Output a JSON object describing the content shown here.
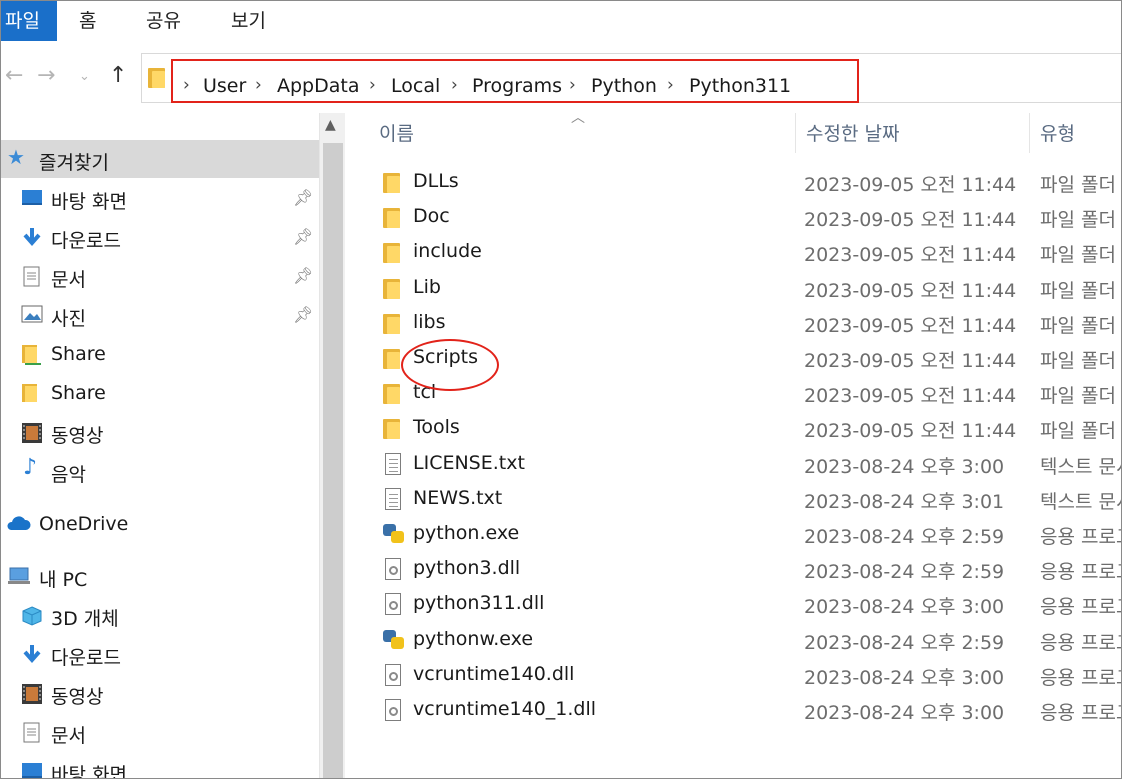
{
  "ribbon": {
    "tabs": [
      "파일",
      "홈",
      "공유",
      "보기"
    ],
    "active_index": 0
  },
  "address": {
    "segments": [
      "User",
      "AppData",
      "Local",
      "Programs",
      "Python",
      "Python311"
    ]
  },
  "nav": {
    "quick_access": "즐겨찾기",
    "items": [
      {
        "label": "바탕 화면",
        "icon": "desktop-icon",
        "pinned": true
      },
      {
        "label": "다운로드",
        "icon": "download-icon",
        "pinned": true
      },
      {
        "label": "문서",
        "icon": "document-icon",
        "pinned": true
      },
      {
        "label": "사진",
        "icon": "picture-icon",
        "pinned": true
      },
      {
        "label": "Share",
        "icon": "shared-folder-icon",
        "pinned": false
      },
      {
        "label": "Share",
        "icon": "folder-icon",
        "pinned": false
      },
      {
        "label": "동영상",
        "icon": "video-icon",
        "pinned": false
      },
      {
        "label": "음악",
        "icon": "music-icon",
        "pinned": false
      }
    ],
    "onedrive": "OneDrive",
    "this_pc": "내 PC",
    "pc_items": [
      {
        "label": "3D 개체",
        "icon": "3d-objects-icon"
      },
      {
        "label": "다운로드",
        "icon": "download-icon"
      },
      {
        "label": "동영상",
        "icon": "video-icon"
      },
      {
        "label": "문서",
        "icon": "document-icon"
      },
      {
        "label": "바탕 화면",
        "icon": "desktop-icon"
      }
    ]
  },
  "columns": {
    "name": "이름",
    "date": "수정한 날짜",
    "type": "유형"
  },
  "files": [
    {
      "name": "DLLs",
      "date": "2023-09-05 오전 11:44",
      "type": "파일 폴더",
      "kind": "folder"
    },
    {
      "name": "Doc",
      "date": "2023-09-05 오전 11:44",
      "type": "파일 폴더",
      "kind": "folder"
    },
    {
      "name": "include",
      "date": "2023-09-05 오전 11:44",
      "type": "파일 폴더",
      "kind": "folder"
    },
    {
      "name": "Lib",
      "date": "2023-09-05 오전 11:44",
      "type": "파일 폴더",
      "kind": "folder"
    },
    {
      "name": "libs",
      "date": "2023-09-05 오전 11:44",
      "type": "파일 폴더",
      "kind": "folder"
    },
    {
      "name": "Scripts",
      "date": "2023-09-05 오전 11:44",
      "type": "파일 폴더",
      "kind": "folder"
    },
    {
      "name": "tcl",
      "date": "2023-09-05 오전 11:44",
      "type": "파일 폴더",
      "kind": "folder"
    },
    {
      "name": "Tools",
      "date": "2023-09-05 오전 11:44",
      "type": "파일 폴더",
      "kind": "folder"
    },
    {
      "name": "LICENSE.txt",
      "date": "2023-08-24 오후 3:00",
      "type": "텍스트 문서",
      "kind": "text"
    },
    {
      "name": "NEWS.txt",
      "date": "2023-08-24 오후 3:01",
      "type": "텍스트 문서",
      "kind": "text"
    },
    {
      "name": "python.exe",
      "date": "2023-08-24 오후 2:59",
      "type": "응용 프로그램",
      "kind": "exe"
    },
    {
      "name": "python3.dll",
      "date": "2023-08-24 오후 2:59",
      "type": "응용 프로그램 확장",
      "kind": "dll"
    },
    {
      "name": "python311.dll",
      "date": "2023-08-24 오후 3:00",
      "type": "응용 프로그램 확장",
      "kind": "dll"
    },
    {
      "name": "pythonw.exe",
      "date": "2023-08-24 오후 2:59",
      "type": "응용 프로그램",
      "kind": "exe"
    },
    {
      "name": "vcruntime140.dll",
      "date": "2023-08-24 오후 3:00",
      "type": "응용 프로그램 확장",
      "kind": "dll"
    },
    {
      "name": "vcruntime140_1.dll",
      "date": "2023-08-24 오후 3:00",
      "type": "응용 프로그램 확장",
      "kind": "dll"
    }
  ],
  "annotations": {
    "highlighted_item": "Scripts"
  },
  "colors": {
    "ribbon_active": "#1a6fc9",
    "annotation_red": "#e2231a",
    "folder_yellow": "#ffd867"
  }
}
